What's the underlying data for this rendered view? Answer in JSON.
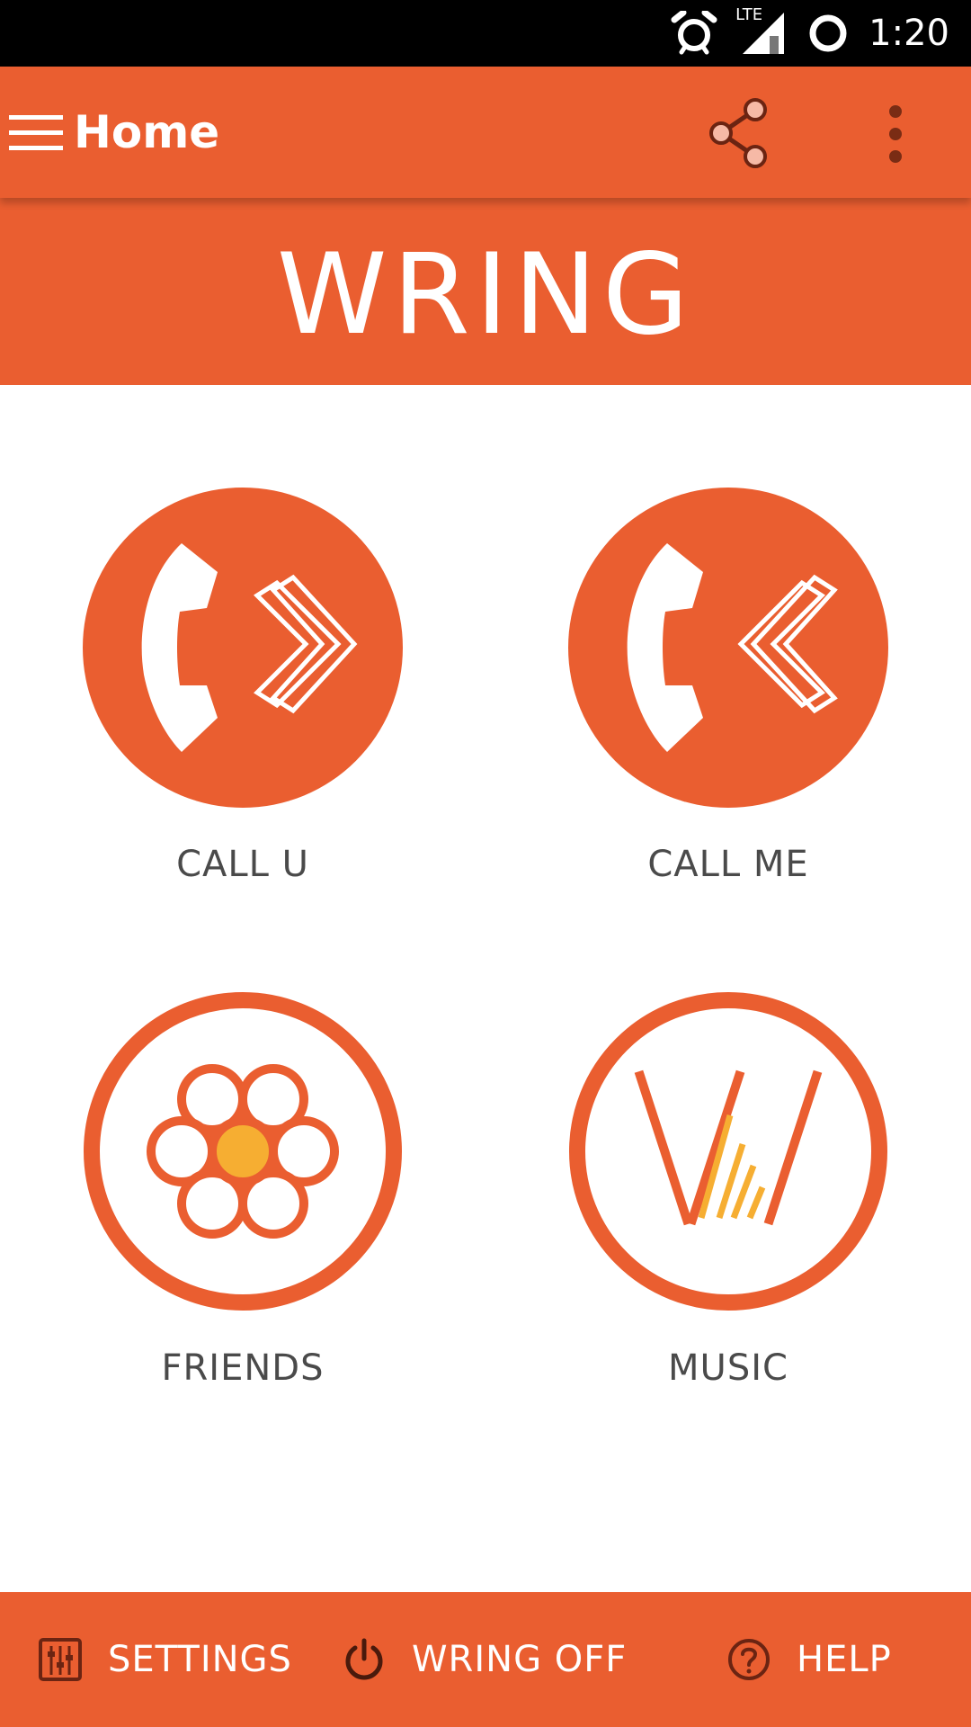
{
  "status_bar": {
    "time": "1:20",
    "network": "LTE"
  },
  "app_bar": {
    "title": "Home",
    "menu_icon": "hamburger-menu-icon",
    "share_icon": "share-icon",
    "overflow_icon": "more-vert-icon"
  },
  "brand": {
    "logo_text": "WRING"
  },
  "tiles": [
    {
      "label": "CALL U",
      "icon": "outgoing-call-icon"
    },
    {
      "label": "CALL ME",
      "icon": "incoming-call-icon"
    },
    {
      "label": "FRIENDS",
      "icon": "friends-flower-icon"
    },
    {
      "label": "MUSIC",
      "icon": "music-w-icon"
    }
  ],
  "bottom_bar": {
    "settings_label": "SETTINGS",
    "wring_off_label": "WRING OFF",
    "help_label": "HELP"
  },
  "colors": {
    "primary": "#ea5e30",
    "accent": "#f6ae32",
    "label_text": "#4a4a4a",
    "icon_dark": "#6b2412"
  }
}
